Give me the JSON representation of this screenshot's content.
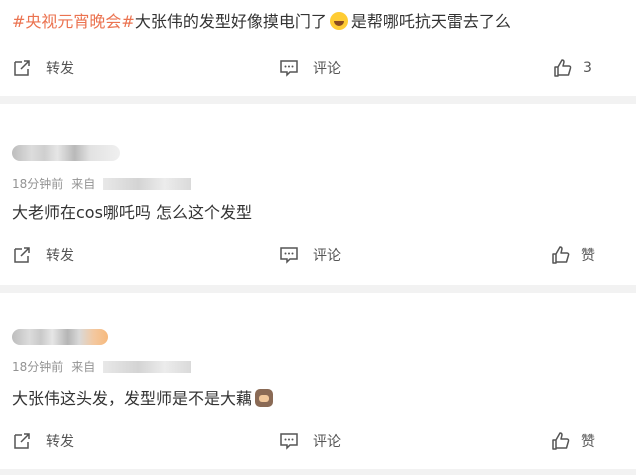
{
  "posts": [
    {
      "text_parts": [
        "#央视元宵晚会#",
        "大张伟的发型好像摸电门了",
        "是帮哪吒抗天雷去了么"
      ],
      "emoji": "laugh-emoji",
      "actions": {
        "repost": "转发",
        "comment": "评论",
        "like": "3"
      }
    },
    {
      "time": "18分钟前",
      "source_prefix": "来自",
      "text": "大老师在cos哪吒吗 怎么这个发型",
      "actions": {
        "repost": "转发",
        "comment": "评论",
        "like": "赞"
      }
    },
    {
      "time": "18分钟前",
      "source_prefix": "来自",
      "text": "大张伟这头发，发型师是不是大藕",
      "emoji": "cat-emoji",
      "actions": {
        "repost": "转发",
        "comment": "评论",
        "like": "赞"
      }
    }
  ],
  "icons": [
    "repost-icon",
    "comment-icon",
    "like-icon"
  ],
  "colors": {
    "topic": "#eb7350",
    "separator": "#f2f2f2",
    "meta": "#939393"
  }
}
